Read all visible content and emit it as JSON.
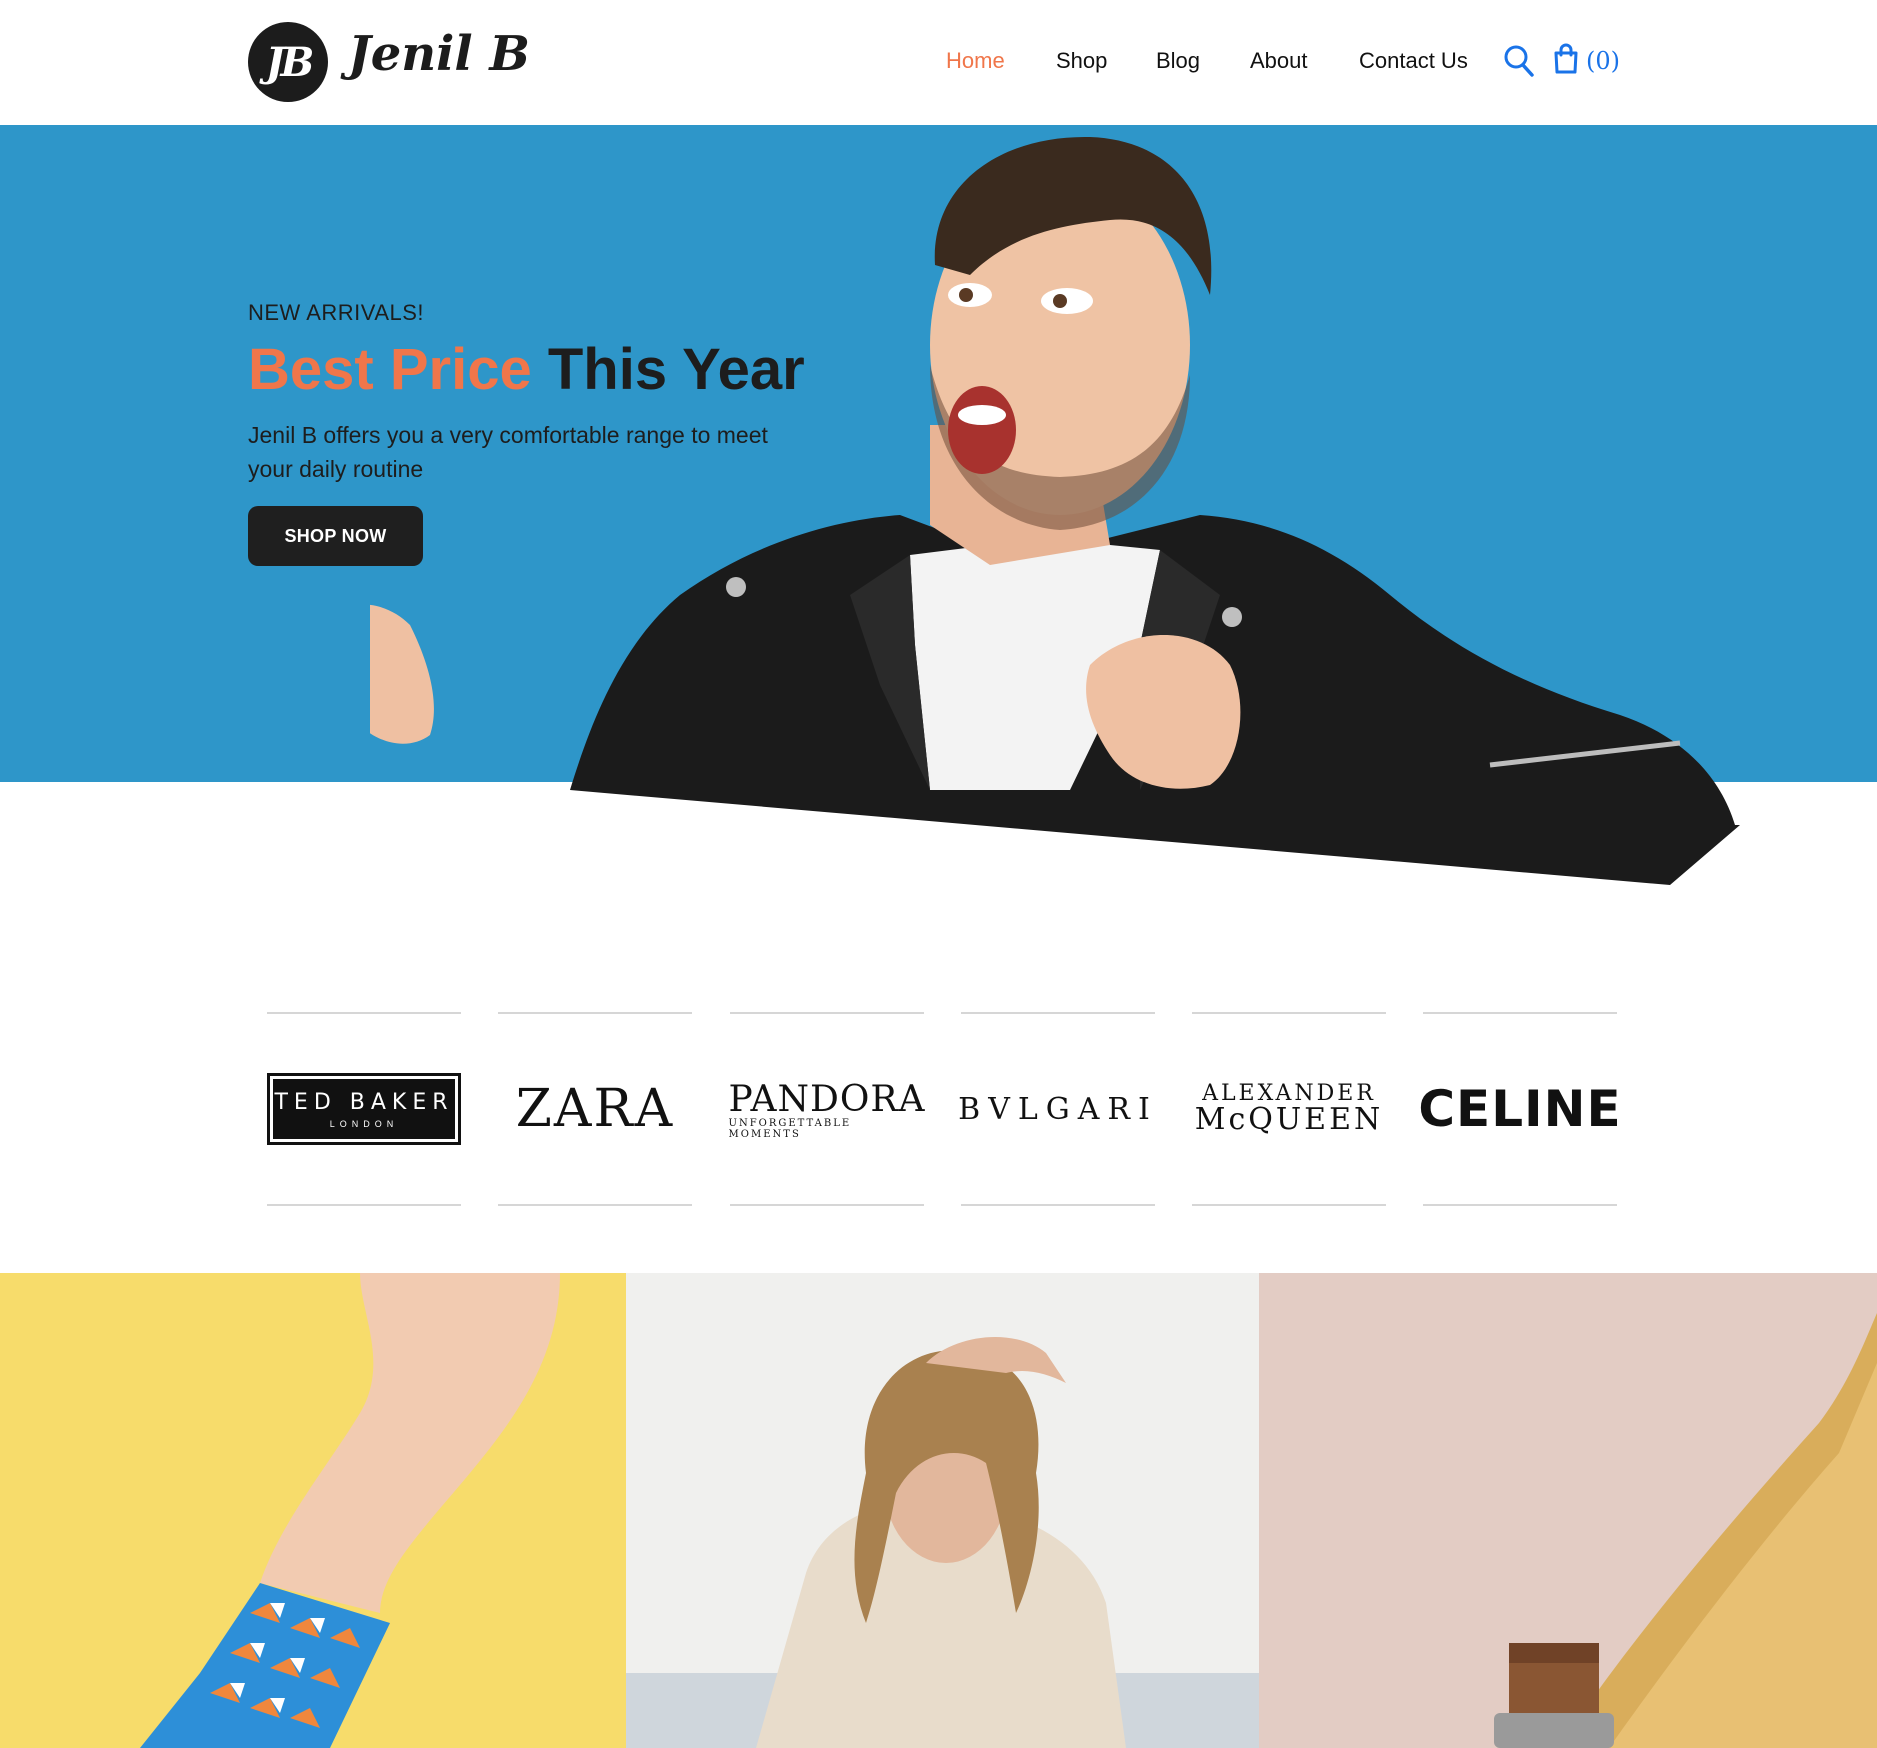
{
  "header": {
    "logo_mark": "JB",
    "logo_text": "Jenil B",
    "nav": [
      "Home",
      "Shop",
      "Blog",
      "About",
      "Contact Us"
    ],
    "active_nav": "Home",
    "cart_count": "(0)",
    "icons": {
      "search": "search-icon",
      "cart": "shopping-bag-icon"
    }
  },
  "hero": {
    "kicker": "NEW ARRIVALS!",
    "headline_accent": "Best Price",
    "headline_rest": "This Year",
    "subtitle": "Jenil B offers you a very comfortable range to meet your daily routine",
    "cta": "SHOP NOW"
  },
  "brands": {
    "ted_baker": {
      "name": "TED BAKER",
      "sub": "LONDON"
    },
    "zara": "ZARA",
    "pandora": {
      "name": "PANDORA",
      "sub": "UNFORGETTABLE MOMENTS"
    },
    "bvlgari": "BVLGARI",
    "mcqueen": {
      "line1": "ALEXANDER",
      "line2": "McQUEEN"
    },
    "celine": "CELINE"
  },
  "colors": {
    "accent": "#f0764a",
    "hero_bg": "#2e96c9",
    "dark": "#1d1d1d",
    "link_blue": "#1a73e8",
    "tile_yellow": "#f7dc6b",
    "tile_light": "#f0f0ee",
    "tile_blush": "#e3ccc4"
  }
}
